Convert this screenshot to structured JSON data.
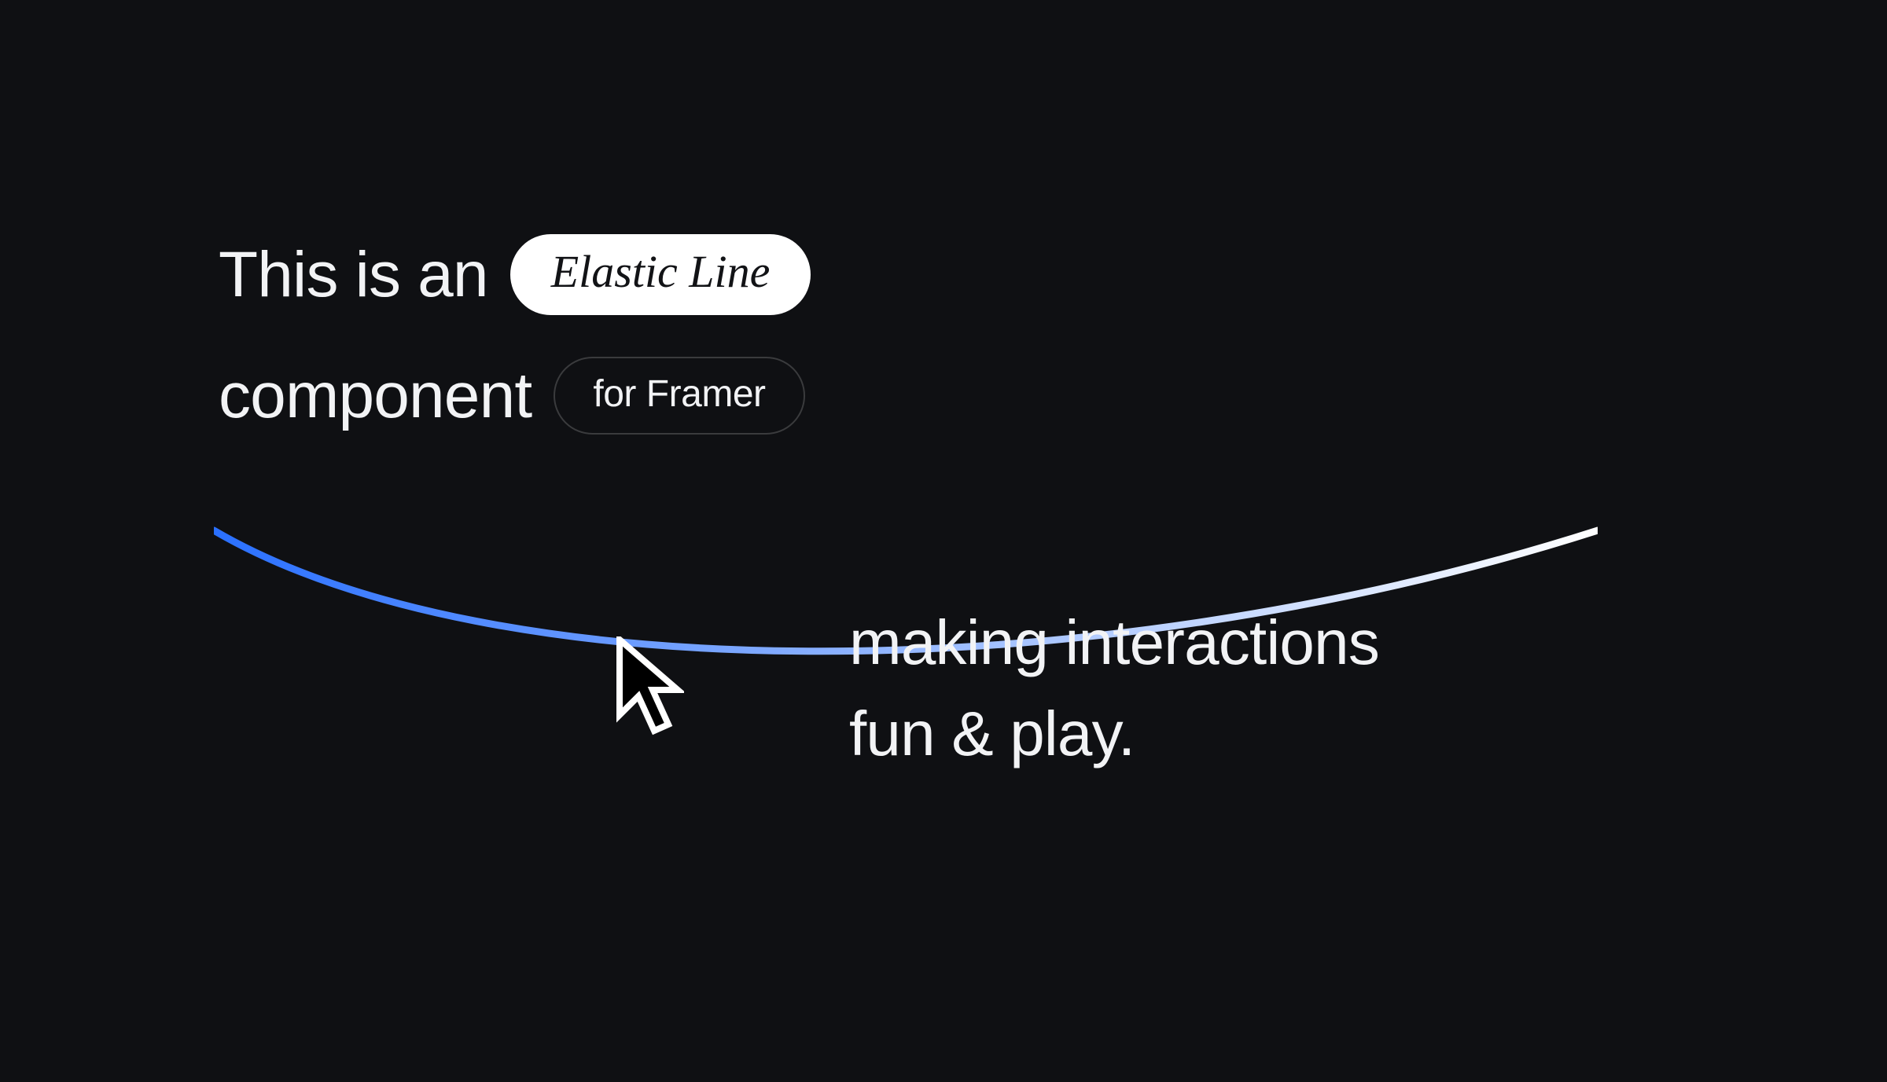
{
  "line1": {
    "text_before": "This is an",
    "pill_label": "Elastic Line"
  },
  "line2": {
    "text_before": "component",
    "pill_label": "for Framer"
  },
  "tagline": {
    "line_a": "making interactions",
    "line_b": "fun & play."
  },
  "colors": {
    "bg": "#0f1013",
    "fg": "#f2f3f5",
    "grad_start": "#2a70ff",
    "grad_end": "#ffffff"
  }
}
